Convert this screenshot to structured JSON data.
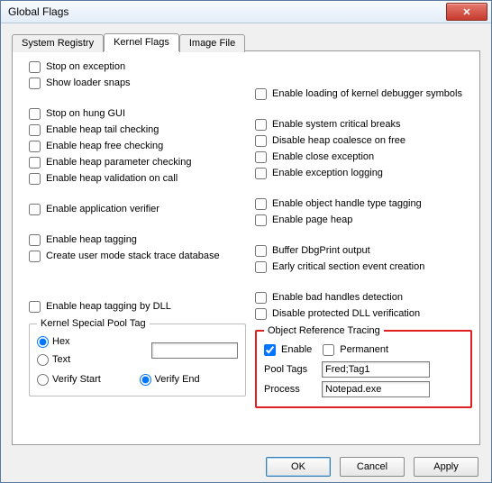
{
  "window": {
    "title": "Global Flags"
  },
  "tabs": {
    "system_registry": "System Registry",
    "kernel_flags": "Kernel Flags",
    "image_file": "Image File"
  },
  "left": {
    "stop_exception": "Stop on exception",
    "show_loader": "Show loader snaps",
    "stop_hung_gui": "Stop on hung GUI",
    "heap_tail": "Enable heap tail checking",
    "heap_free": "Enable heap free checking",
    "heap_param": "Enable heap parameter checking",
    "heap_valid": "Enable heap validation on call",
    "app_verifier": "Enable application verifier",
    "heap_tagging": "Enable heap tagging",
    "stack_trace_db": "Create user mode stack trace database",
    "heap_tag_dll": "Enable heap tagging by DLL"
  },
  "right": {
    "kernel_dbg_syms": "Enable loading of kernel debugger symbols",
    "sys_crit_breaks": "Enable system critical breaks",
    "heap_coalesce": "Disable heap coalesce on free",
    "close_exception": "Enable close exception",
    "exception_logging": "Enable exception logging",
    "handle_type_tag": "Enable object handle type tagging",
    "page_heap": "Enable page heap",
    "dbgprint": "Buffer DbgPrint output",
    "early_crit": "Early critical section event creation",
    "bad_handles": "Enable bad handles detection",
    "protected_dll": "Disable protected DLL verification"
  },
  "kspt": {
    "legend": "Kernel Special Pool Tag",
    "hex": "Hex",
    "text": "Text",
    "verify_start": "Verify Start",
    "verify_end": "Verify End",
    "value": ""
  },
  "ort": {
    "legend": "Object Reference Tracing",
    "enable": "Enable",
    "permanent": "Permanent",
    "pooltags_label": "Pool Tags",
    "pooltags_value": "Fred;Tag1",
    "process_label": "Process",
    "process_value": "Notepad.exe",
    "enable_checked": true
  },
  "buttons": {
    "ok": "OK",
    "cancel": "Cancel",
    "apply": "Apply"
  }
}
